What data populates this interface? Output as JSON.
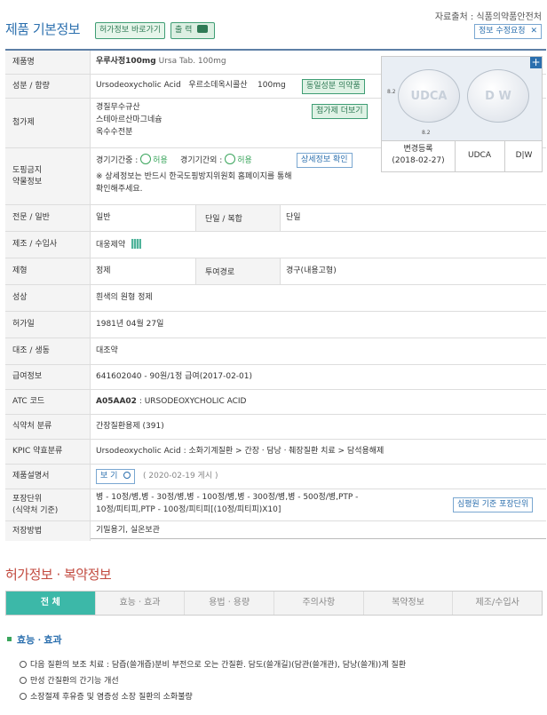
{
  "header": {
    "title": "제품 기본정보",
    "permit_shortcut": "허가정보 바로가기",
    "print_label": "출 력",
    "source": "자료출처 : 식품의약품안전처",
    "edit_request": "정보 수정요청"
  },
  "info": {
    "product_name_label": "제품명",
    "product_name_kr": "우루사정100mg",
    "product_name_en": "Ursa Tab. 100mg",
    "ingredient_label": "성분 / 함량",
    "ingredient_value": "Ursodeoxycholic Acid   우르소데옥시콜산    100mg",
    "same_ingredient_button": "동일성분 의약품",
    "additive_label": "첨가제",
    "additives": [
      "경질무수규산",
      "스테아르산마그네슘",
      "옥수수전분"
    ],
    "additive_more_button": "첨가제 더보기",
    "doping_label_1": "도핑금지",
    "doping_label_2": "약물정보",
    "doping_in_label": "경기기간중 :",
    "doping_in_value": "허용",
    "doping_out_label": "경기기간외 :",
    "doping_out_value": "허용",
    "doping_detail_button": "상세정보 확인",
    "doping_note_1": "※ 상세정보는 반드시 한국도핑방지위원회 홈페이지를 통해",
    "doping_note_2": "확인해주세요.",
    "specialty_label": "전문 / 일반",
    "specialty_value": "일반",
    "single_combo_label": "단일 / 복합",
    "single_combo_value": "단일",
    "manufacturer_label": "제조 / 수입사",
    "manufacturer_value": "대웅제약",
    "form_label": "제형",
    "form_value": "정제",
    "route_label": "투여경로",
    "route_value": "경구(내용고형)",
    "appearance_label": "성상",
    "appearance_value": "흰색의 원형 정제",
    "permit_date_label": "허가일",
    "permit_date_value": "1981년 04월 27일",
    "reference_label": "대조 / 생동",
    "reference_value": "대조약",
    "benefit_label": "급여정보",
    "benefit_value": "641602040 - 90원/1정 급여(2017-02-01)",
    "atc_label": "ATC 코드",
    "atc_code": "A05AA02",
    "atc_desc": " : URSODEOXYCHOLIC ACID",
    "mfds_class_label": "식약처 분류",
    "mfds_class_value": "간장질환용제 (391)",
    "kpic_label": "KPIC 약효분류",
    "kpic_value": "Ursodeoxycholic Acid : 소화기계질환 > 간장ㆍ담낭ㆍ췌장질환 치료 > 담석용해제",
    "leaflet_label": "제품설명서",
    "leaflet_button": "보 기",
    "leaflet_date": "( 2020-02-19 게시 )",
    "package_label_1": "포장단위",
    "package_label_2": "(식약처 기준)",
    "package_value_1": "병 - 10정/병,병 - 30정/병,병 - 100정/병,병 - 300정/병,병 - 500정/병,PTP -",
    "package_value_2": "10정/피티피,PTP - 100정/피티피[(10정/피티피)X10]",
    "hira_package_button": "심평원 기준 포장단위",
    "storage_label": "저장방법",
    "storage_value": "기밀용기, 실온보관"
  },
  "pill_image": {
    "imprint_front": "UDCA",
    "imprint_back": "D W",
    "ruler_h": "8.2",
    "ruler_w": "8.2",
    "change_label": "변경등록",
    "change_date": "(2018-02-27)",
    "mark_front": "UDCA",
    "mark_back": "D|W"
  },
  "section2": {
    "title": "허가정보 · 복약정보",
    "tabs": [
      "전 체",
      "효능ㆍ효과",
      "용법ㆍ용량",
      "주의사항",
      "복약정보",
      "제조/수입사"
    ],
    "effect_heading": "효능ㆍ효과",
    "effects": [
      "다음 질환의 보조 치료 : 담즙(쓸개즙)분비 부전으로 오는 간질환. 담도(쓸개길)(담관(쓸개관), 담낭(쓸개))계 질환",
      "만성 간질환의 간기능 개선",
      "소장절제 후유증 및 염증성 소장 질환의 소화불량"
    ]
  },
  "colors": {
    "accent_blue": "#2b6fae",
    "accent_green": "#3aa55c",
    "tab_active": "#3cb8a8",
    "section_red": "#c24a3f"
  }
}
